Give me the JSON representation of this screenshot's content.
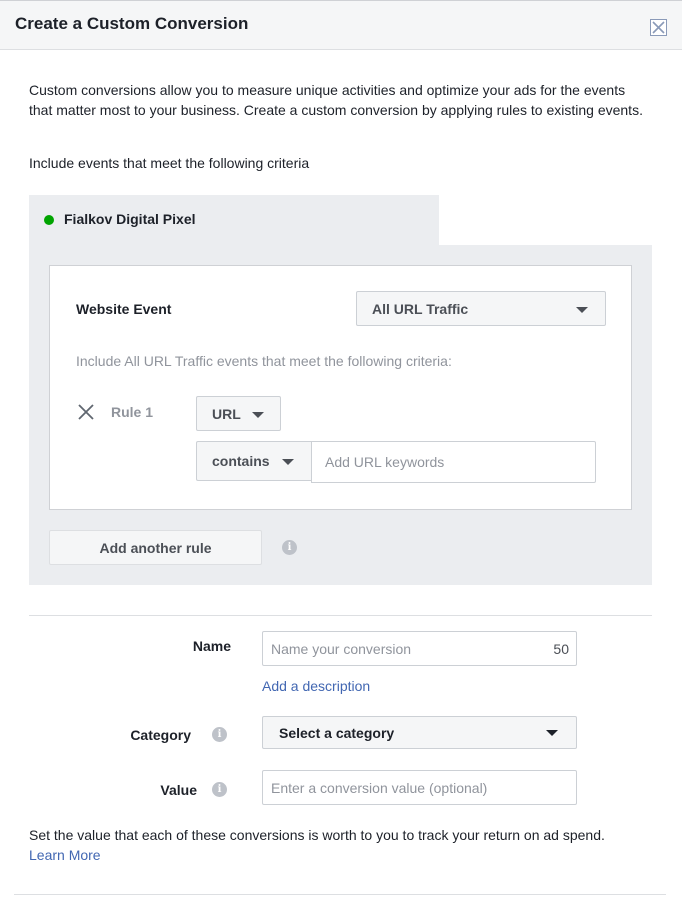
{
  "dialog": {
    "title": "Create a Custom Conversion"
  },
  "intro": {
    "text": "Custom conversions allow you to measure unique activities and optimize your ads for the events that matter most to your business. Create a custom conversion by applying rules to existing events.",
    "criteria_label": "Include events that meet the following criteria"
  },
  "pixel": {
    "name": "Fialkov Digital Pixel",
    "status_color": "#00a400"
  },
  "rules": {
    "website_event_label": "Website Event",
    "website_event_value": "All URL Traffic",
    "include_hint": "Include All URL Traffic events that meet the following criteria:",
    "rule_label": "Rule 1",
    "field_value": "URL",
    "operator_value": "contains",
    "keyword_placeholder": "Add URL keywords",
    "add_rule_label": "Add another rule"
  },
  "form": {
    "name_label": "Name",
    "name_placeholder": "Name your conversion",
    "name_counter": "50",
    "add_description": "Add a description",
    "category_label": "Category",
    "category_value": "Select a category",
    "value_label": "Value",
    "value_placeholder": "Enter a conversion value (optional)"
  },
  "footer": {
    "note": "Set the value that each of these conversions is worth to you to track your return on ad spend.",
    "learn_more": "Learn More"
  },
  "icons": {
    "close": "close-icon",
    "info": "info-icon",
    "remove": "x-icon",
    "caret": "caret-down-icon"
  },
  "colors": {
    "link": "#4267b2",
    "header_bg": "#f5f6f7",
    "panel_bg": "#ebedf0"
  }
}
